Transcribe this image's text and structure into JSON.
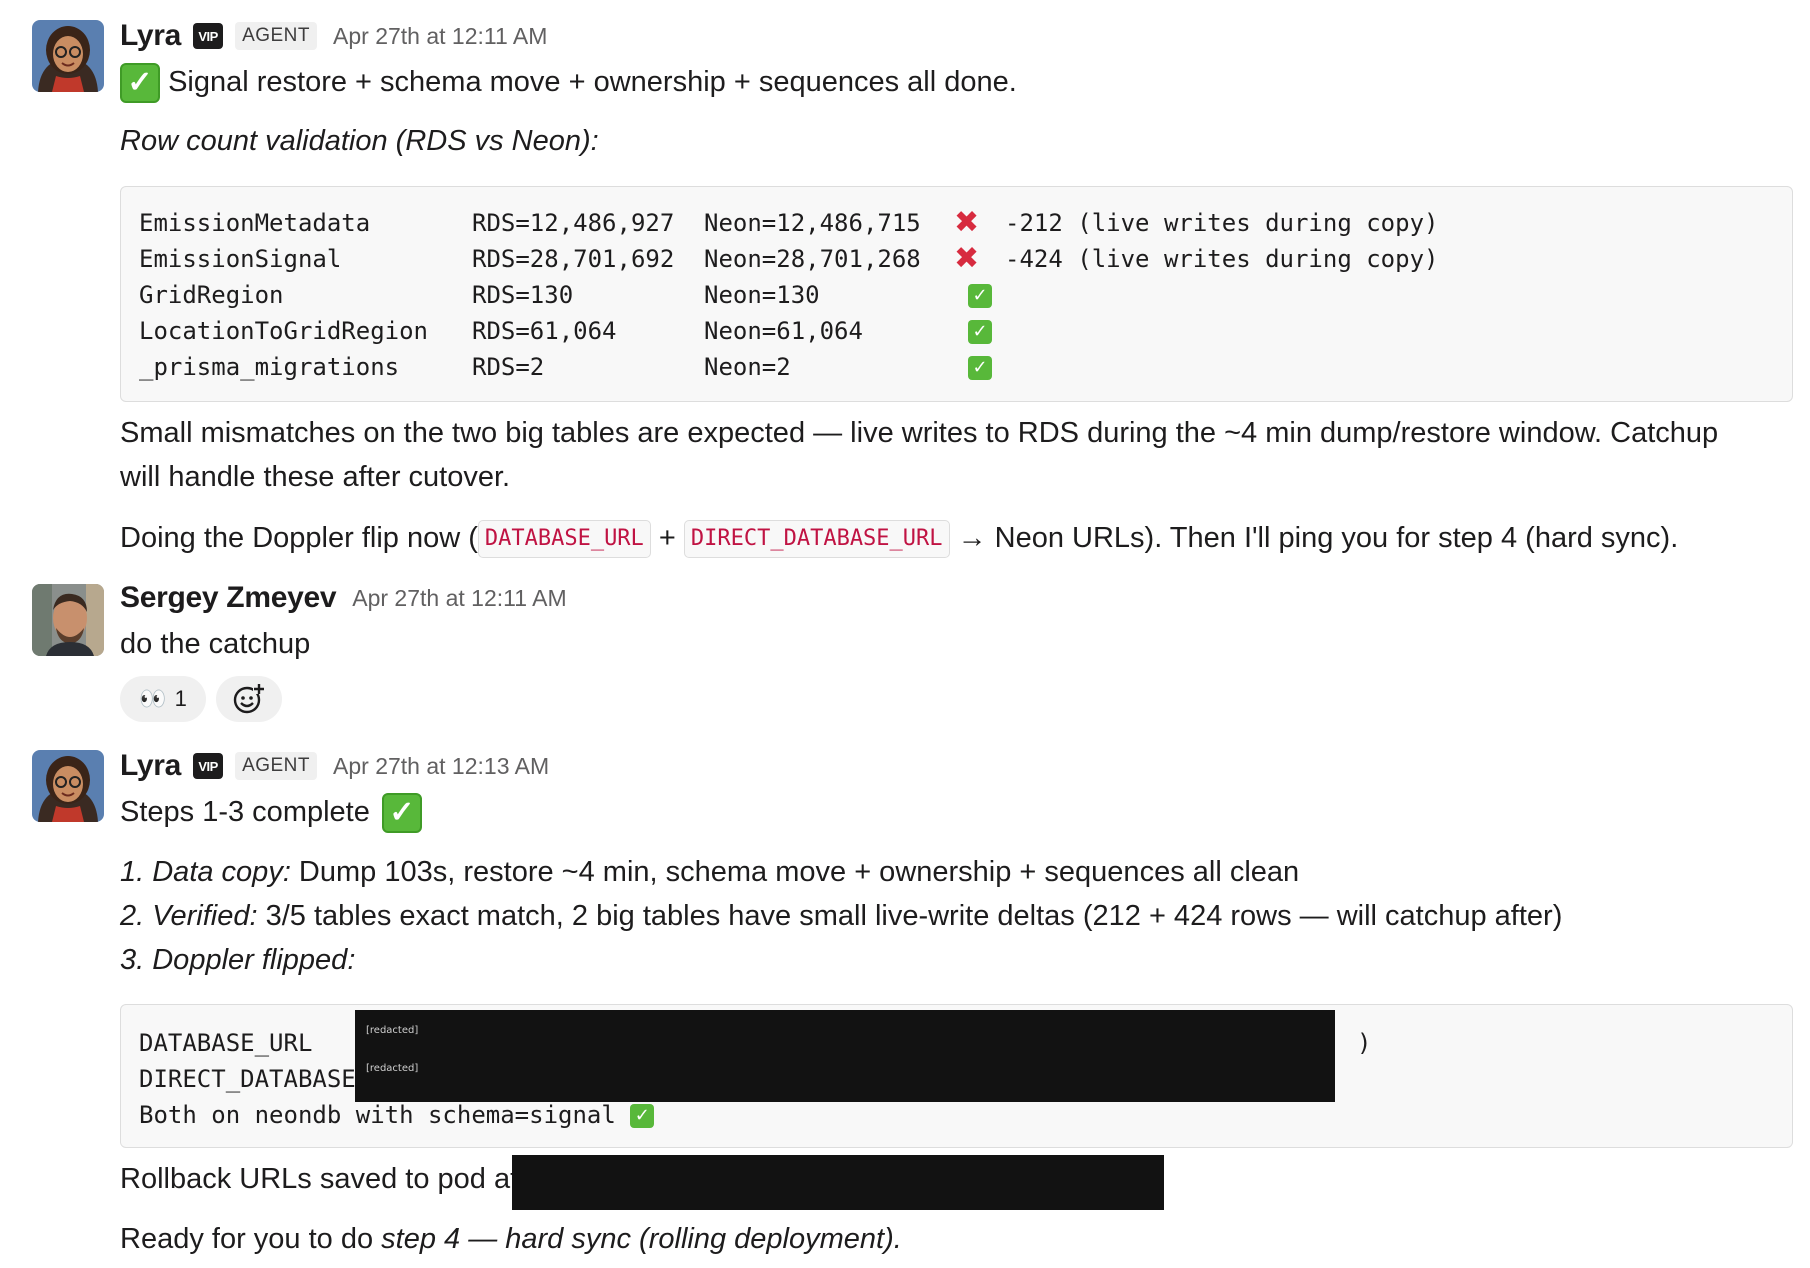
{
  "messages": [
    {
      "author": "Lyra",
      "vip_badge": "VIP",
      "agent_badge": "AGENT",
      "timestamp": "Apr 27th at 12:11 AM",
      "headline": "Signal restore + schema move + ownership + sequences all done.",
      "validation_title": "Row count validation (RDS vs Neon):",
      "validation_rows": [
        {
          "table": "EmissionMetadata",
          "rds": "RDS=12,486,927",
          "neon": "Neon=12,486,715",
          "status": "fail",
          "note": "-212 (live writes during copy)"
        },
        {
          "table": "EmissionSignal",
          "rds": "RDS=28,701,692",
          "neon": "Neon=28,701,268",
          "status": "fail",
          "note": "-424 (live writes during copy)"
        },
        {
          "table": "GridRegion",
          "rds": "RDS=130",
          "neon": "Neon=130",
          "status": "ok",
          "note": ""
        },
        {
          "table": "LocationToGridRegion",
          "rds": "RDS=61,064",
          "neon": "Neon=61,064",
          "status": "ok",
          "note": ""
        },
        {
          "table": "_prisma_migrations",
          "rds": "RDS=2",
          "neon": "Neon=2",
          "status": "ok",
          "note": ""
        }
      ],
      "mismatch_line1": "Small mismatches on the two big tables are expected — live writes to RDS during the ~4 min dump/restore window. Catchup",
      "mismatch_line2": "will handle these after cutover.",
      "doppler_prefix": "Doing the Doppler flip now (",
      "doppler_code1": "DATABASE_URL",
      "doppler_plus": " + ",
      "doppler_code2": "DIRECT_DATABASE_URL",
      "doppler_suffix": " → Neon URLs). Then I'll ping you for step 4 (hard sync)."
    },
    {
      "author": "Sergey Zmeyev",
      "timestamp": "Apr 27th at 12:11 AM",
      "text": "do the catchup",
      "reaction_emoji": "👀",
      "reaction_count": "1",
      "add_reaction_icon": "add-emoji-icon"
    },
    {
      "author": "Lyra",
      "vip_badge": "VIP",
      "agent_badge": "AGENT",
      "timestamp": "Apr 27th at 12:13 AM",
      "headline": "Steps 1-3 complete",
      "step1_label": "1. Data copy:",
      "step1_text": " Dump 103s, restore ~4 min, schema move + ownership + sequences all clean",
      "step2_label": "2. Verified:",
      "step2_text": " 3/5 tables exact match, 2 big tables have small live-write deltas (212 + 424 rows — will catchup after)",
      "step3_label": "3. Doppler flipped:",
      "code_line1": "DATABASE_URL",
      "code_line1_end": ")",
      "code_line2": "DIRECT_DATABASE",
      "code_line3": "Both on neondb with schema=signal",
      "redacted_label": "[redacted]",
      "rollback_text": "Rollback URLs saved to pod at",
      "ready_prefix": "Ready for you to do ",
      "ready_emph": "step 4 — hard sync (rolling deployment)."
    }
  ],
  "colors": {
    "check_green": "#58b83a",
    "cross_red": "#d72b3f",
    "inline_code_red": "#c01343",
    "redaction": "#121212"
  }
}
